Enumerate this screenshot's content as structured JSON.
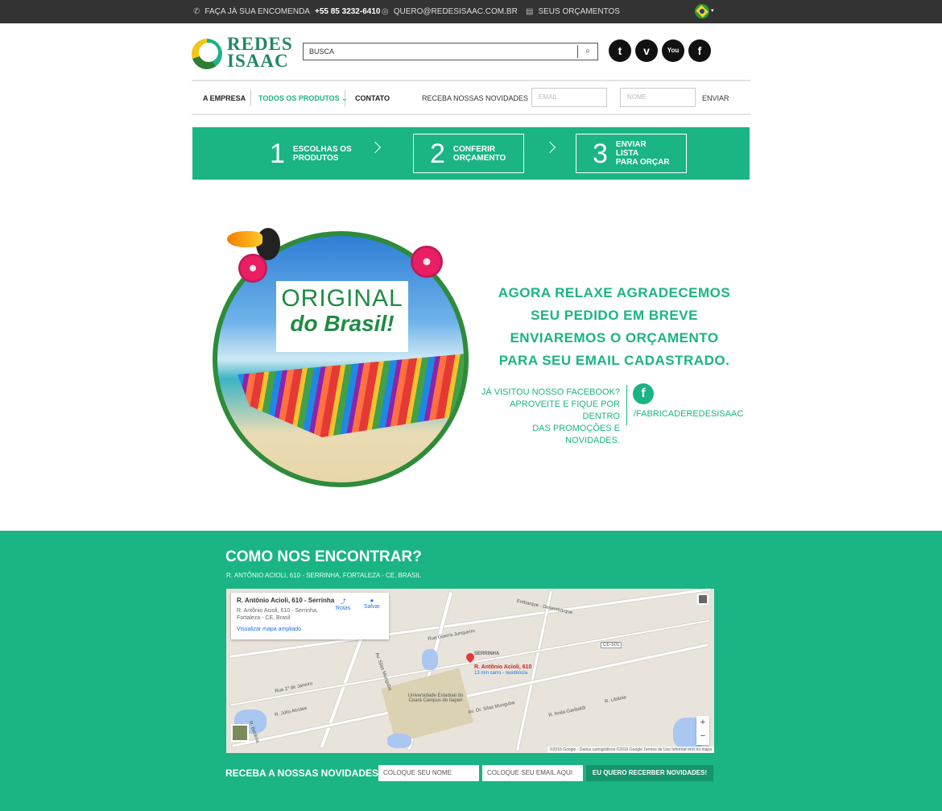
{
  "topbar": {
    "phone_label": "FAÇA JÁ SUA ENCOMENDA",
    "phone_number": "+55 85 3232-6410",
    "email": "QUERO@REDESISAAC.COM.BR",
    "quotes": "SEUS ORÇAMENTOS",
    "icons": {
      "phone": "phone-icon",
      "email": "at-icon",
      "quotes": "clipboard-icon"
    }
  },
  "header": {
    "logo_line1": "REDES",
    "logo_line2": "ISAAC",
    "search_placeholder": "BUSCA",
    "social": [
      "twitter",
      "vimeo",
      "youtube",
      "facebook"
    ]
  },
  "nav": {
    "items": [
      "A EMPRESA",
      "TODOS OS PRODUTOS",
      "CONTATO"
    ],
    "caret": "⌄",
    "newsletter_label": "RECEBA NOSSAS NOVIDADES",
    "email_placeholder": "EMAIL",
    "name_placeholder": "NOME",
    "send": "ENVIAR"
  },
  "steps": [
    {
      "num": "1",
      "line1": "ESCOLHAS OS",
      "line2": "PRODUTOS"
    },
    {
      "num": "2",
      "line1": "CONFERIR",
      "line2": "ORÇAMENTO"
    },
    {
      "num": "3",
      "line1": "ENVIAR LISTA",
      "line2": "PARA ORÇAR"
    }
  ],
  "hero": {
    "sign_line1": "ORIGINAL",
    "sign_line2": "do Brasil!"
  },
  "message": "AGORA RELAXE AGRADECEMOS SEU PEDIDO EM BREVE ENVIAREMOS O ORÇAMENTO PARA SEU EMAIL CADASTRADO.",
  "facebook": {
    "line1": "JÁ VISITOU NOSSO FACEBOOK?",
    "line2": "APROVEITE E FIQUE POR DENTRO",
    "line3": "DAS PROMOÇÕES E NOVIDADES.",
    "handle": "/FABRICADEREDESISAAC"
  },
  "footer": {
    "title": "COMO NOS ENCONTRAR?",
    "address": "R. ANTÔNIO ACIOLI, 610 - SERRINHA, FORTALEZA - CE, BRASIL",
    "map": {
      "info_title": "R. Antônio Acioli, 610 - Serrinha",
      "info_addr": "R. Antônio Acioli, 610 - Serrinha, Fortaleza - CE, Brasil",
      "info_link": "Visualizar mapa ampliado",
      "routes": "Rotas",
      "save": "Salvar",
      "pin_label": "R. Antônio Acioli, 610",
      "pin_sub": "13 min carro - residência",
      "district": "SERRINHA",
      "labels": [
        "Rua 1º de Janeiro",
        "Rua Guerra Junqueiro",
        "Av. Silas Munguba",
        "R. Júlio Alcides",
        "R. Betânia",
        "Universidade Estadual do Ceará Campus do Itaperi",
        "Embarque - Desembarque",
        "Av. Dr. Silas Munguba",
        "R. Anita Garibaldi",
        "R. Libânia",
        "CE-501"
      ],
      "attribution": "©2016 Google - Dados cartográficos ©2016 Google   Termos de Uso   Informar erro no mapa",
      "zoom_in": "+",
      "zoom_out": "−"
    },
    "newsletter_label": "RECEBA A NOSSAS NOVIDADES",
    "name_placeholder": "COLOQUE SEU NOME",
    "email_placeholder": "COLOQUE SEU EMAIL AQUI",
    "button": "EU QUERO RECERBER NOVIDADES!"
  },
  "colors": {
    "brand": "#1ab485",
    "dark": "#333333"
  }
}
